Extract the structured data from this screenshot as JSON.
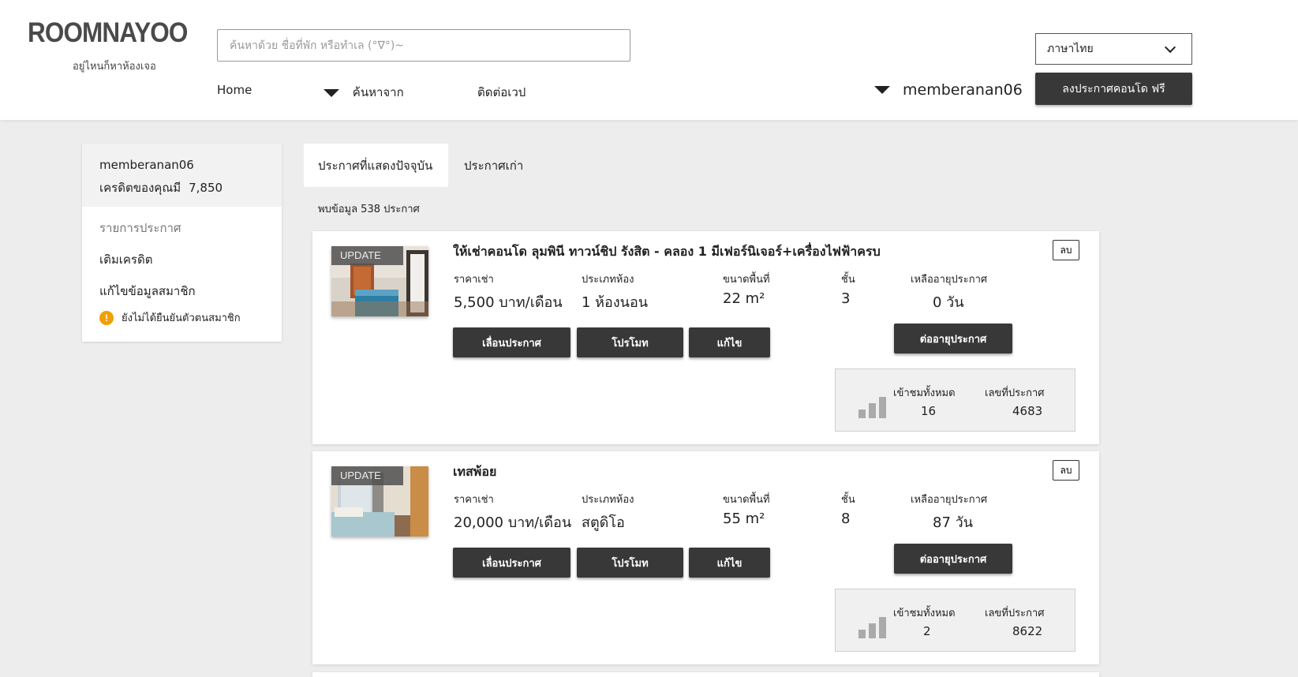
{
  "header": {
    "logo": "ROOMNAYOO",
    "tagline": "อยู่ไหนก็หาห้องเจอ",
    "search_placeholder": "ค้นหาด้วย ชื่อที่พัก หรือทำเล (°∇°)~",
    "nav": {
      "home": "Home",
      "search_from": "ค้นหาจาก",
      "contact": "ติดต่อเวป"
    },
    "language": "ภาษาไทย",
    "username": "memberanan06",
    "post_button": "ลงประกาศคอนโด ฟรี"
  },
  "sidebar": {
    "username": "memberanan06",
    "credit_label": "เครดิตของคุณมี",
    "credit_value": "7,850",
    "links": [
      "รายการประกาศ",
      "เติมเครดิต",
      "แก้ไขข้อมูลสมาชิก"
    ],
    "warning": "ยังไม่ได้ยืนยันตัวตนสมาชิก",
    "warning_icon": "warning-icon"
  },
  "tabs": {
    "current": "ประกาศที่แสดงปัจจุบัน",
    "old": "ประกาศเก่า"
  },
  "found_text": "พบข้อมูล 538 ประกาศ",
  "labels": {
    "price": "ราคาเช่า",
    "room_type": "ประเภทห้อง",
    "area": "ขนาดพื้นที่",
    "floor": "ชั้น",
    "remaining": "เหลืออายุประกาศ",
    "views": "เข้าชมทั้งหมด",
    "listing_no": "เลขที่ประกาศ",
    "update_badge": "UPDATE",
    "delete": "ลบ",
    "bump": "เลื่อนประกาศ",
    "promote": "โปรโมท",
    "edit": "แก้ไข",
    "renew": "ต่ออายุประกาศ"
  },
  "listings": [
    {
      "title": "ให้เช่าคอนโด ลุมพินี ทาวน์ชิป รังสิต - คลอง 1 มีเฟอร์นิเจอร์+เครื่องไฟฟ้าครบ",
      "price": "5,500 บาท/เดือน",
      "room_type": "1 ห้องนอน",
      "area": "22 m²",
      "floor": "3",
      "remaining": "0 วัน",
      "views": "16",
      "listing_no": "4683"
    },
    {
      "title": "เทสพ้อย",
      "price": "20,000 บาท/เดือน",
      "room_type": "สตูดิโอ",
      "area": "55 m²",
      "floor": "8",
      "remaining": "87 วัน",
      "views": "2",
      "listing_no": "8622"
    }
  ],
  "colors": {
    "dark_button": "#383838",
    "warning": "#f0a000",
    "page_bg": "#ededed"
  }
}
